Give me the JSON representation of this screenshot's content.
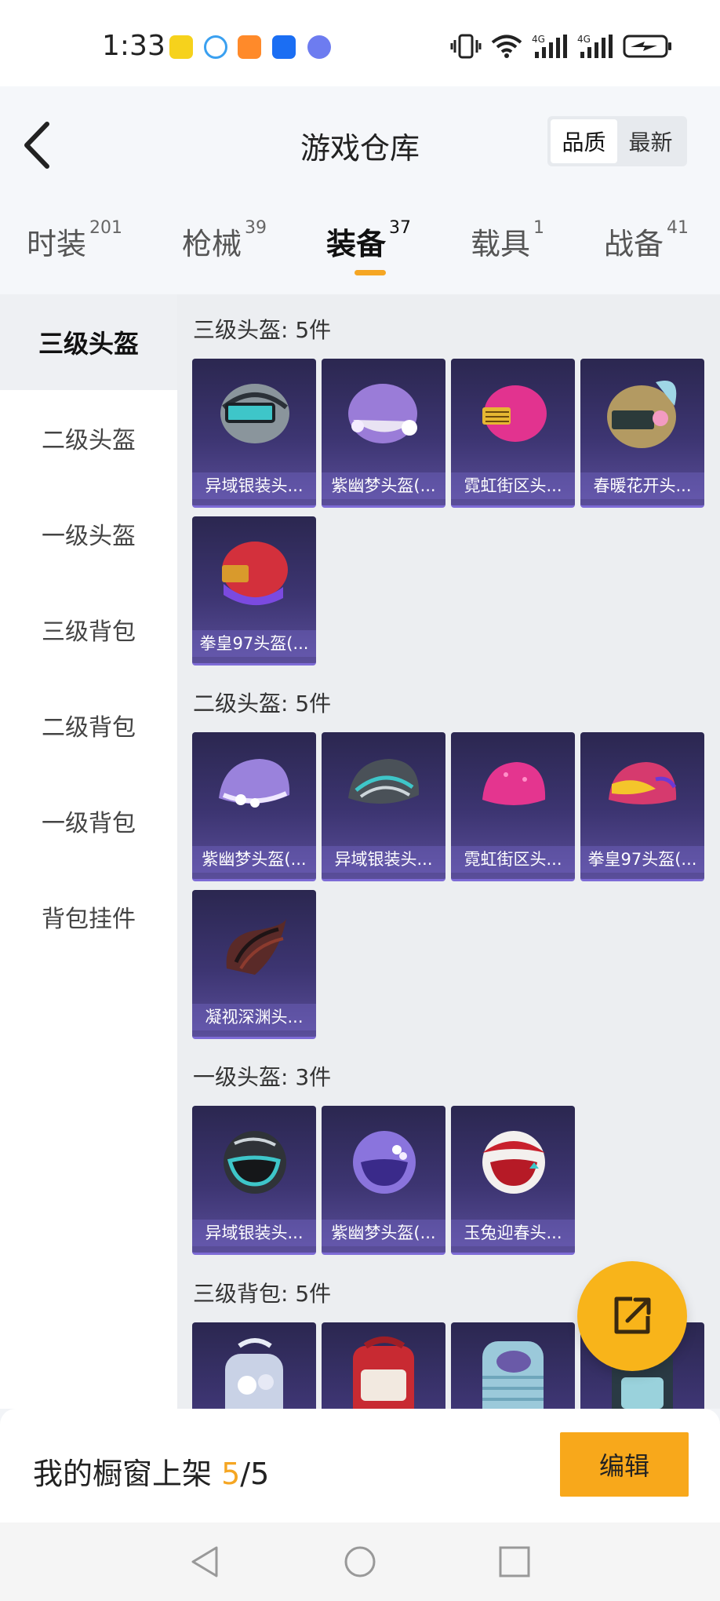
{
  "status_bar": {
    "time": "1:33"
  },
  "header": {
    "title": "游戏仓库",
    "sort_options": [
      "品质",
      "最新"
    ],
    "sort_selected": "品质"
  },
  "category_tabs": [
    {
      "label": "时装",
      "count": "201"
    },
    {
      "label": "枪械",
      "count": "39"
    },
    {
      "label": "装备",
      "count": "37"
    },
    {
      "label": "载具",
      "count": "1"
    },
    {
      "label": "战备",
      "count": "41"
    }
  ],
  "active_tab": "装备",
  "sidebar": {
    "items": [
      "三级头盔",
      "二级头盔",
      "一级头盔",
      "三级背包",
      "二级背包",
      "一级背包",
      "背包挂件"
    ],
    "active": "三级头盔"
  },
  "sections": [
    {
      "title": "三级头盔: 5件",
      "items": [
        "异域银装头...",
        "紫幽梦头盔(...",
        "霓虹街区头...",
        "春暖花开头...",
        "拳皇97头盔(..."
      ]
    },
    {
      "title": "二级头盔: 5件",
      "items": [
        "紫幽梦头盔(...",
        "异域银装头...",
        "霓虹街区头...",
        "拳皇97头盔(...",
        "凝视深渊头..."
      ]
    },
    {
      "title": "一级头盔: 3件",
      "items": [
        "异域银装头...",
        "紫幽梦头盔(...",
        "玉兔迎春头..."
      ]
    },
    {
      "title": "三级背包: 5件",
      "items": [
        "",
        "",
        "",
        ""
      ]
    }
  ],
  "bottom_bar": {
    "label": "我的橱窗上架 ",
    "current": "5",
    "total": "/5",
    "edit_label": "编辑"
  },
  "colors": {
    "accent": "#f5a623",
    "card_bg": "#3d3572",
    "fab": "#f8b41a"
  }
}
